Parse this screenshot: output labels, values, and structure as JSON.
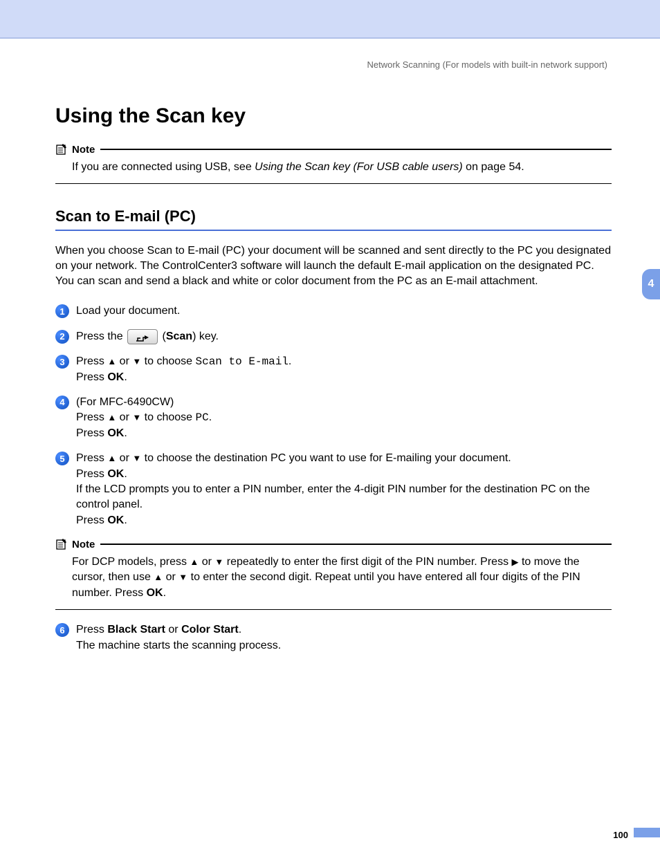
{
  "header_right": "Network Scanning  (For models with built-in network support)",
  "h1": "Using the Scan key",
  "note1": {
    "title": "Note",
    "body_prefix": "If you are connected using USB, see ",
    "body_italic": "Using the Scan key (For USB cable users)",
    "body_suffix": " on page 54."
  },
  "h2": "Scan to E-mail (PC)",
  "para": "When you choose Scan to E-mail (PC) your document will be scanned and sent directly to the PC you designated on your network. The ControlCenter3 software will launch the default E-mail application on the designated PC. You can scan and send a black and white or color document from the PC as an E-mail attachment.",
  "steps": {
    "s1": {
      "text": "Load your document."
    },
    "s2": {
      "prefix": "Press the ",
      "paren_open": "(",
      "scan": "Scan",
      "paren_close": ") key."
    },
    "s3": {
      "line1_prefix": "Press ",
      "line1_mid": " or ",
      "line1_choose": " to choose ",
      "code": "Scan to E-mail",
      "line1_suffix": ".",
      "line2_prefix": "Press ",
      "ok": "OK",
      "line2_suffix": "."
    },
    "s4": {
      "line0": "(For MFC-6490CW)",
      "line1_prefix": "Press ",
      "line1_mid": " or ",
      "line1_choose": " to choose ",
      "code": "PC",
      "line1_suffix": ".",
      "line2_prefix": "Press ",
      "ok": "OK",
      "line2_suffix": "."
    },
    "s5": {
      "line1_prefix": "Press ",
      "line1_mid": " or ",
      "line1_suffix": " to choose the destination PC you want to use for E-mailing your document.",
      "line2_prefix": "Press ",
      "ok": "OK",
      "line2_suffix": ".",
      "line3": "If the LCD prompts you to enter a PIN number, enter the 4-digit PIN number for the destination PC on the control panel.",
      "line4_prefix": "Press ",
      "line4_suffix": "."
    },
    "s6": {
      "line1_prefix": "Press ",
      "black": "Black Start",
      "or": " or ",
      "color": "Color Start",
      "line1_suffix": ".",
      "line2": "The machine starts the scanning process."
    }
  },
  "note2": {
    "title": "Note",
    "t1": "For DCP models, press ",
    "t2": " or ",
    "t3": " repeatedly to enter the first digit of the PIN number. Press ",
    "t4": " to move the cursor, then use ",
    "t5": " or ",
    "t6": " to enter the second digit. Repeat until you have entered all four digits of the PIN number. Press ",
    "ok": "OK",
    "t7": "."
  },
  "side_tab": "4",
  "page_number": "100"
}
